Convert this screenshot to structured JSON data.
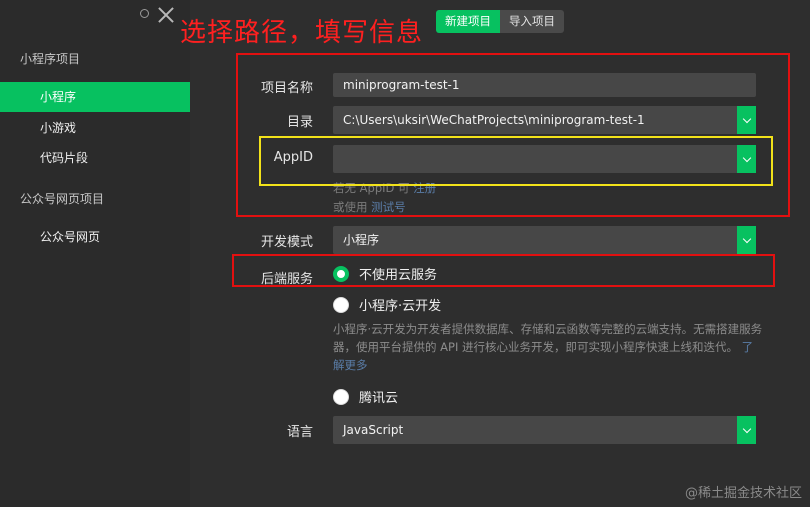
{
  "sidebar": {
    "section1_title": "小程序项目",
    "items1": [
      "小程序",
      "小游戏",
      "代码片段"
    ],
    "section2_title": "公众号网页项目",
    "items2": [
      "公众号网页"
    ]
  },
  "tabs": {
    "new": "新建项目",
    "import": "导入项目"
  },
  "annotation": "选择路径，填写信息",
  "form": {
    "name_label": "项目名称",
    "name_value": "miniprogram-test-1",
    "dir_label": "目录",
    "dir_value": "C:\\Users\\uksir\\WeChatProjects\\miniprogram-test-1",
    "appid_label": "AppID",
    "appid_value": "",
    "appid_hint_prefix": "若无 AppID 可",
    "appid_hint_link": "注册",
    "appid_hint2_prefix": "或使用",
    "appid_hint2_link": "测试号",
    "mode_label": "开发模式",
    "mode_value": "小程序",
    "backend_label": "后端服务",
    "backend_opt1": "不使用云服务",
    "backend_opt2": "小程序·云开发",
    "cloud_desc": "小程序·云开发为开发者提供数据库、存储和云函数等完整的云端支持。无需搭建服务器，使用平台提供的 API 进行核心业务开发，即可实现小程序快速上线和迭代。",
    "cloud_desc_link": "了解更多",
    "backend_opt3": "腾讯云",
    "lang_label": "语言",
    "lang_value": "JavaScript"
  },
  "watermark": "@稀土掘金技术社区",
  "colors": {
    "accent": "#07c160",
    "annotation": "#e21010",
    "highlight": "#f2e21a"
  }
}
